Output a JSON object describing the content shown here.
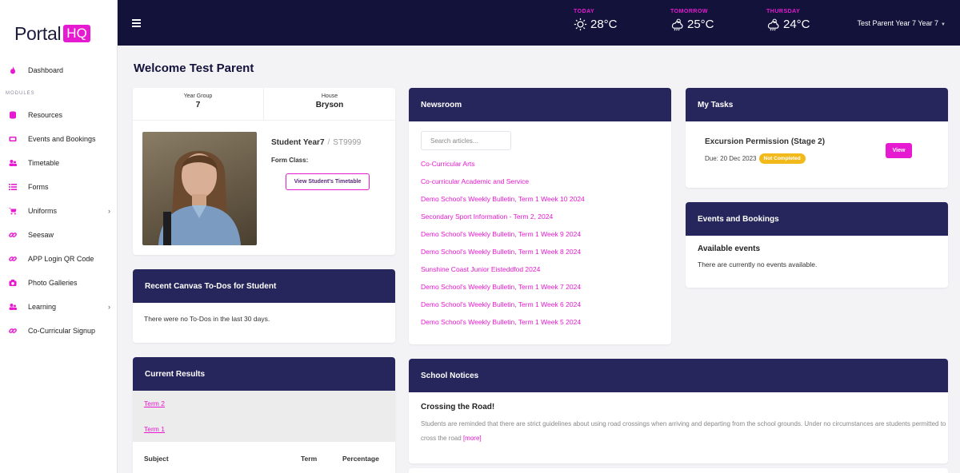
{
  "brand": {
    "logo_text": "Portal",
    "logo_badge": "HQ",
    "accent": "#e61ad0",
    "header_bg": "#12123a",
    "card_head_bg": "#27265c"
  },
  "sidebar": {
    "dashboard": {
      "label": "Dashboard",
      "icon": "flame-icon"
    },
    "section_label": "MODULES",
    "items": [
      {
        "label": "Resources",
        "icon": "database-icon"
      },
      {
        "label": "Events and Bookings",
        "icon": "ticket-icon"
      },
      {
        "label": "Timetable",
        "icon": "users-icon"
      },
      {
        "label": "Forms",
        "icon": "list-icon"
      },
      {
        "label": "Uniforms",
        "icon": "cart-icon",
        "chevron": true
      },
      {
        "label": "Seesaw",
        "icon": "link-icon"
      },
      {
        "label": "APP Login QR Code",
        "icon": "link-icon"
      },
      {
        "label": "Photo Galleries",
        "icon": "camera-icon"
      },
      {
        "label": "Learning",
        "icon": "users-icon",
        "chevron": true
      },
      {
        "label": "Co-Curricular Signup",
        "icon": "link-icon"
      }
    ]
  },
  "header": {
    "weather": [
      {
        "day": "TODAY",
        "temp": "28°C",
        "icon": "sun-icon"
      },
      {
        "day": "TOMORROW",
        "temp": "25°C",
        "icon": "cloud-rain-icon"
      },
      {
        "day": "THURSDAY",
        "temp": "24°C",
        "icon": "cloud-rain-icon"
      }
    ],
    "user": "Test Parent Year 7 Year 7"
  },
  "main": {
    "welcome": "Welcome Test Parent",
    "student": {
      "year_group_label": "Year Group",
      "year_group": "7",
      "house_label": "House",
      "house": "Bryson",
      "name": "Student Year7",
      "id": "ST9999",
      "form_class_label": "Form Class:",
      "timetable_button": "View Student's Timetable"
    },
    "canvas": {
      "title": "Recent Canvas To-Dos for Student",
      "empty": "There were no To-Dos in the last 30 days."
    },
    "results": {
      "title": "Current Results",
      "terms": [
        "Term 2",
        "Term 1"
      ],
      "columns": [
        "Subject",
        "Term",
        "Percentage"
      ]
    },
    "newsroom": {
      "title": "Newsroom",
      "search_placeholder": "Search articles...",
      "articles": [
        "Co-Curricular Arts",
        "Co-curricular Academic and Service",
        "Demo School's Weekly Bulletin, Term 1 Week 10 2024",
        "Secondary Sport Information - Term 2, 2024",
        "Demo School's Weekly Bulletin, Term 1 Week 9 2024",
        "Demo School's Weekly Bulletin, Term 1 Week 8 2024",
        "Sunshine Coast Junior Eisteddfod 2024",
        "Demo School's Weekly Bulletin, Term 1 Week 7 2024",
        "Demo School's Weekly Bulletin, Term 1 Week 6 2024",
        "Demo School's Weekly Bulletin, Term 1 Week 5 2024"
      ]
    },
    "notices": {
      "title": "School Notices",
      "item_title": "Crossing the Road!",
      "item_body": "Students are reminded that there are strict guidelines about using road crossings when arriving and departing from the school grounds. Under no circumstances are students permitted to cross the road",
      "more": "[more]"
    },
    "tasks": {
      "title": "My Tasks",
      "task_title": "Excursion Permission (Stage 2)",
      "due": "Due: 20 Dec 2023",
      "status": "Not Completed",
      "view_button": "View"
    },
    "events": {
      "title": "Events and Bookings",
      "subtitle": "Available events",
      "empty": "There are currently no events available."
    }
  }
}
